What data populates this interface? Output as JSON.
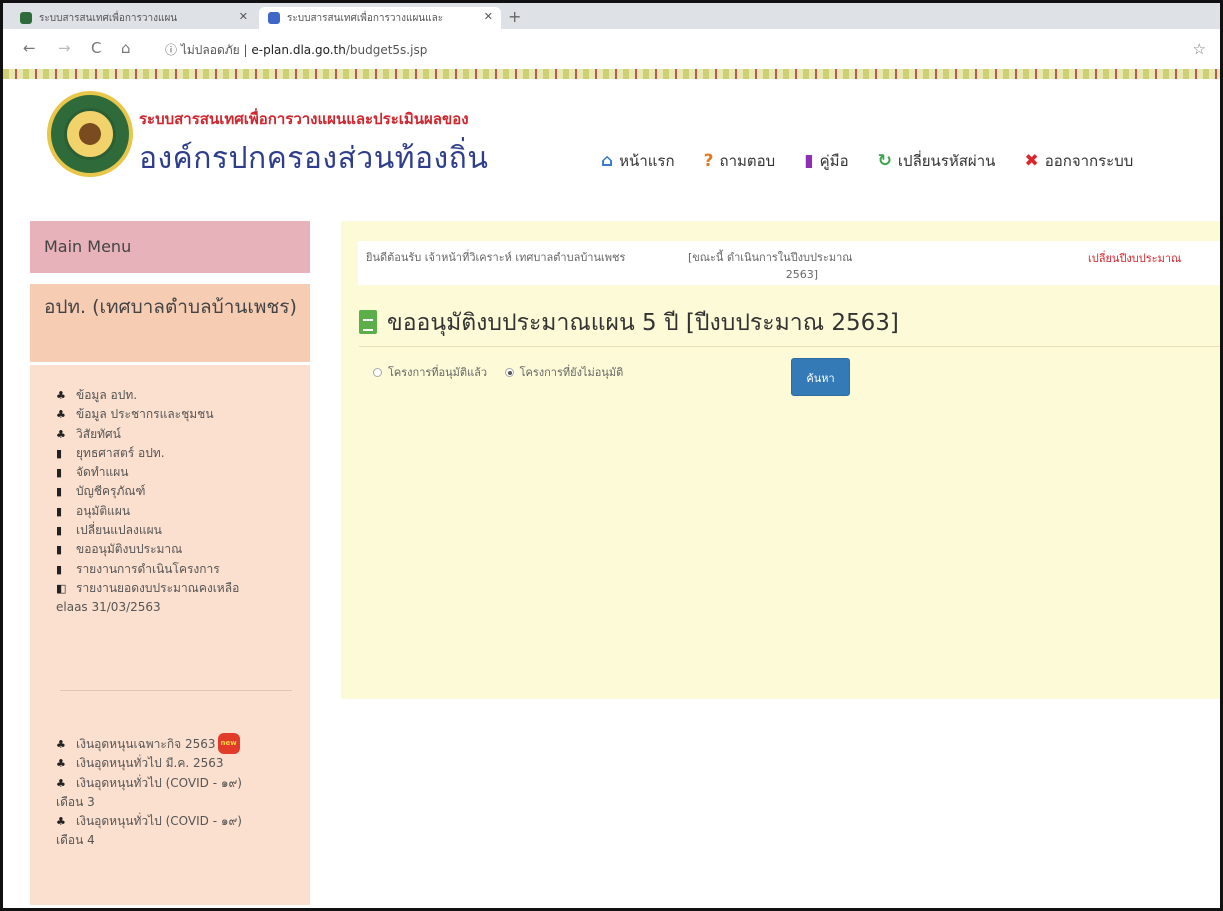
{
  "browser": {
    "tabs": [
      {
        "title": "ระบบสารสนเทศเพื่อการวางแผน",
        "fav_color": "#2f6b3a"
      },
      {
        "title": "ระบบสารสนเทศเพื่อการวางแผนและ",
        "fav_color": "#3f66c8"
      }
    ],
    "new_tab": "+",
    "back": "←",
    "forward": "→",
    "reload": "C",
    "home": "⌂",
    "security": "ⓘ ไม่ปลอดภัย",
    "url_sep": "|",
    "host": "e-plan.dla.go.th",
    "path": "/budget5s.jsp",
    "bookmark": "☆"
  },
  "header": {
    "subtitle": "ระบบสารสนเทศเพื่อการวางแผนและประเมินผลของ",
    "title": "องค์กรปกครองส่วนท้องถิ่น",
    "nav": [
      {
        "icon": "⌂",
        "icon_color": "#3a7ac8",
        "label": "หน้าแรก",
        "name": "home"
      },
      {
        "icon": "?",
        "icon_color": "#e07a22",
        "label": "ถามตอบ",
        "name": "faq"
      },
      {
        "icon": "▮",
        "icon_color": "#8b2fb5",
        "label": "คู่มือ",
        "name": "manual"
      },
      {
        "icon": "↻",
        "icon_color": "#3aa64a",
        "label": "เปลี่ยนรหัสผ่าน",
        "name": "change-password"
      },
      {
        "icon": "✖",
        "icon_color": "#d9252d",
        "label": "ออกจากระบบ",
        "name": "logout"
      }
    ]
  },
  "sidebar": {
    "main_menu": "Main Menu",
    "org": "อปท. (เทศบาลตำบลบ้านเพชร)",
    "items": [
      {
        "icon": "♣",
        "label": "ข้อมูล อปท."
      },
      {
        "icon": "♣",
        "label": "ข้อมูล ประชากรและชุมชน"
      },
      {
        "icon": "♣",
        "label": "วิสัยทัศน์"
      },
      {
        "icon": "▮",
        "label": "ยุทธศาสตร์ อปท."
      },
      {
        "icon": "▮",
        "label": "จัดทำแผน"
      },
      {
        "icon": "▮",
        "label": "บัญชีครุภัณฑ์"
      },
      {
        "icon": "▮",
        "label": "อนุมัติแผน"
      },
      {
        "icon": "▮",
        "label": "เปลี่ยนแปลงแผน"
      },
      {
        "icon": "▮",
        "label": "ขออนุมัติงบประมาณ"
      },
      {
        "icon": "▮",
        "label": "รายงานการดำเนินโครงการ"
      },
      {
        "icon": "◧",
        "label": "รายงานยอดงบประมาณคงเหลือ",
        "label2": "elaas 31/03/2563"
      }
    ],
    "items2": [
      {
        "icon": "♣",
        "label": "เงินอุดหนุนเฉพาะกิจ 2563",
        "badge": "new"
      },
      {
        "icon": "♣",
        "label": "เงินอุดหนุนทั่วไป มี.ค. 2563"
      },
      {
        "icon": "♣",
        "label": "เงินอุดหนุนทั่วไป (COVID - ๑๙)",
        "label2": "เดือน 3"
      },
      {
        "icon": "♣",
        "label": "เงินอุดหนุนทั่วไป (COVID - ๑๙)",
        "label2": "เดือน 4"
      }
    ]
  },
  "main": {
    "welcome": "ยินดีต้อนรับ เจ้าหน้าที่วิเคราะห์ เทศบาลตำบลบ้านเพชร",
    "fiscal_label": "[ขณะนี้ ดำเนินการในปีงบประมาณ",
    "fiscal_year": "2563]",
    "change_year": "เปลี่ยนปีงบประมาณ",
    "heading": "ขออนุมัติงบประมาณแผน 5 ปี [ปีงบประมาณ 2563]",
    "radio_options": [
      {
        "label": "โครงการที่อนุมัติแล้ว",
        "selected": false
      },
      {
        "label": "โครงการที่ยังไม่อนุมัติ",
        "selected": true
      }
    ],
    "search_button": "ค้นหา"
  }
}
